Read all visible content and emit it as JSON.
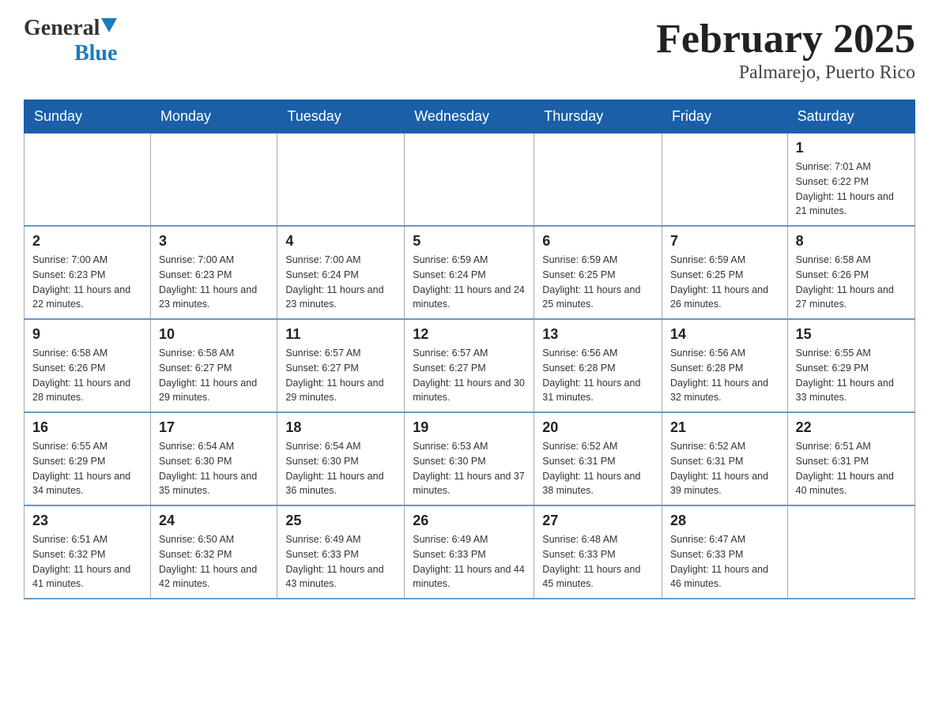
{
  "header": {
    "logo_general": "General",
    "logo_blue": "Blue",
    "month_title": "February 2025",
    "location": "Palmarejo, Puerto Rico"
  },
  "days_of_week": [
    "Sunday",
    "Monday",
    "Tuesday",
    "Wednesday",
    "Thursday",
    "Friday",
    "Saturday"
  ],
  "weeks": [
    [
      {
        "day": "",
        "sunrise": "",
        "sunset": "",
        "daylight": ""
      },
      {
        "day": "",
        "sunrise": "",
        "sunset": "",
        "daylight": ""
      },
      {
        "day": "",
        "sunrise": "",
        "sunset": "",
        "daylight": ""
      },
      {
        "day": "",
        "sunrise": "",
        "sunset": "",
        "daylight": ""
      },
      {
        "day": "",
        "sunrise": "",
        "sunset": "",
        "daylight": ""
      },
      {
        "day": "",
        "sunrise": "",
        "sunset": "",
        "daylight": ""
      },
      {
        "day": "1",
        "sunrise": "Sunrise: 7:01 AM",
        "sunset": "Sunset: 6:22 PM",
        "daylight": "Daylight: 11 hours and 21 minutes."
      }
    ],
    [
      {
        "day": "2",
        "sunrise": "Sunrise: 7:00 AM",
        "sunset": "Sunset: 6:23 PM",
        "daylight": "Daylight: 11 hours and 22 minutes."
      },
      {
        "day": "3",
        "sunrise": "Sunrise: 7:00 AM",
        "sunset": "Sunset: 6:23 PM",
        "daylight": "Daylight: 11 hours and 23 minutes."
      },
      {
        "day": "4",
        "sunrise": "Sunrise: 7:00 AM",
        "sunset": "Sunset: 6:24 PM",
        "daylight": "Daylight: 11 hours and 23 minutes."
      },
      {
        "day": "5",
        "sunrise": "Sunrise: 6:59 AM",
        "sunset": "Sunset: 6:24 PM",
        "daylight": "Daylight: 11 hours and 24 minutes."
      },
      {
        "day": "6",
        "sunrise": "Sunrise: 6:59 AM",
        "sunset": "Sunset: 6:25 PM",
        "daylight": "Daylight: 11 hours and 25 minutes."
      },
      {
        "day": "7",
        "sunrise": "Sunrise: 6:59 AM",
        "sunset": "Sunset: 6:25 PM",
        "daylight": "Daylight: 11 hours and 26 minutes."
      },
      {
        "day": "8",
        "sunrise": "Sunrise: 6:58 AM",
        "sunset": "Sunset: 6:26 PM",
        "daylight": "Daylight: 11 hours and 27 minutes."
      }
    ],
    [
      {
        "day": "9",
        "sunrise": "Sunrise: 6:58 AM",
        "sunset": "Sunset: 6:26 PM",
        "daylight": "Daylight: 11 hours and 28 minutes."
      },
      {
        "day": "10",
        "sunrise": "Sunrise: 6:58 AM",
        "sunset": "Sunset: 6:27 PM",
        "daylight": "Daylight: 11 hours and 29 minutes."
      },
      {
        "day": "11",
        "sunrise": "Sunrise: 6:57 AM",
        "sunset": "Sunset: 6:27 PM",
        "daylight": "Daylight: 11 hours and 29 minutes."
      },
      {
        "day": "12",
        "sunrise": "Sunrise: 6:57 AM",
        "sunset": "Sunset: 6:27 PM",
        "daylight": "Daylight: 11 hours and 30 minutes."
      },
      {
        "day": "13",
        "sunrise": "Sunrise: 6:56 AM",
        "sunset": "Sunset: 6:28 PM",
        "daylight": "Daylight: 11 hours and 31 minutes."
      },
      {
        "day": "14",
        "sunrise": "Sunrise: 6:56 AM",
        "sunset": "Sunset: 6:28 PM",
        "daylight": "Daylight: 11 hours and 32 minutes."
      },
      {
        "day": "15",
        "sunrise": "Sunrise: 6:55 AM",
        "sunset": "Sunset: 6:29 PM",
        "daylight": "Daylight: 11 hours and 33 minutes."
      }
    ],
    [
      {
        "day": "16",
        "sunrise": "Sunrise: 6:55 AM",
        "sunset": "Sunset: 6:29 PM",
        "daylight": "Daylight: 11 hours and 34 minutes."
      },
      {
        "day": "17",
        "sunrise": "Sunrise: 6:54 AM",
        "sunset": "Sunset: 6:30 PM",
        "daylight": "Daylight: 11 hours and 35 minutes."
      },
      {
        "day": "18",
        "sunrise": "Sunrise: 6:54 AM",
        "sunset": "Sunset: 6:30 PM",
        "daylight": "Daylight: 11 hours and 36 minutes."
      },
      {
        "day": "19",
        "sunrise": "Sunrise: 6:53 AM",
        "sunset": "Sunset: 6:30 PM",
        "daylight": "Daylight: 11 hours and 37 minutes."
      },
      {
        "day": "20",
        "sunrise": "Sunrise: 6:52 AM",
        "sunset": "Sunset: 6:31 PM",
        "daylight": "Daylight: 11 hours and 38 minutes."
      },
      {
        "day": "21",
        "sunrise": "Sunrise: 6:52 AM",
        "sunset": "Sunset: 6:31 PM",
        "daylight": "Daylight: 11 hours and 39 minutes."
      },
      {
        "day": "22",
        "sunrise": "Sunrise: 6:51 AM",
        "sunset": "Sunset: 6:31 PM",
        "daylight": "Daylight: 11 hours and 40 minutes."
      }
    ],
    [
      {
        "day": "23",
        "sunrise": "Sunrise: 6:51 AM",
        "sunset": "Sunset: 6:32 PM",
        "daylight": "Daylight: 11 hours and 41 minutes."
      },
      {
        "day": "24",
        "sunrise": "Sunrise: 6:50 AM",
        "sunset": "Sunset: 6:32 PM",
        "daylight": "Daylight: 11 hours and 42 minutes."
      },
      {
        "day": "25",
        "sunrise": "Sunrise: 6:49 AM",
        "sunset": "Sunset: 6:33 PM",
        "daylight": "Daylight: 11 hours and 43 minutes."
      },
      {
        "day": "26",
        "sunrise": "Sunrise: 6:49 AM",
        "sunset": "Sunset: 6:33 PM",
        "daylight": "Daylight: 11 hours and 44 minutes."
      },
      {
        "day": "27",
        "sunrise": "Sunrise: 6:48 AM",
        "sunset": "Sunset: 6:33 PM",
        "daylight": "Daylight: 11 hours and 45 minutes."
      },
      {
        "day": "28",
        "sunrise": "Sunrise: 6:47 AM",
        "sunset": "Sunset: 6:33 PM",
        "daylight": "Daylight: 11 hours and 46 minutes."
      },
      {
        "day": "",
        "sunrise": "",
        "sunset": "",
        "daylight": ""
      }
    ]
  ]
}
